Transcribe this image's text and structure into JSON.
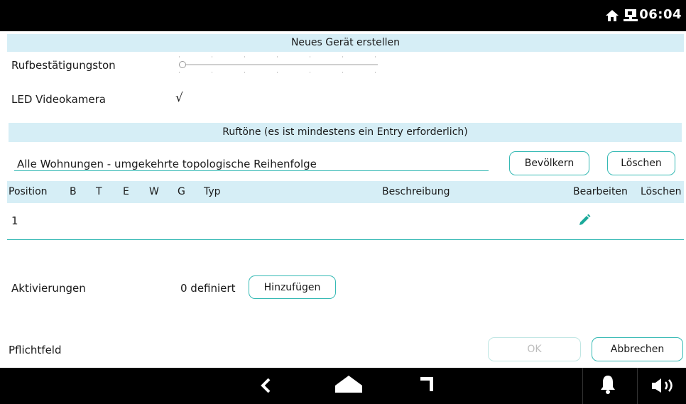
{
  "status": {
    "time": "06:04",
    "icons": [
      "home-icon",
      "network-icon"
    ]
  },
  "header": {
    "title": "Neues Gerät erstellen"
  },
  "form": {
    "ruf_label": "Rufbestätigungston",
    "ruf_slider_value": 0,
    "led_label": "LED Videokamera",
    "led_check": "√"
  },
  "ruftoene": {
    "title": "Ruftöne (es ist mindestens ein Entry erforderlich)",
    "selection": "Alle Wohnungen - umgekehrte topologische Reihenfolge",
    "populate": "Bevölkern",
    "delete": "Löschen"
  },
  "table": {
    "headers": {
      "position": "Position",
      "b": "B",
      "t": "T",
      "e": "E",
      "w": "W",
      "g": "G",
      "typ": "Typ",
      "beschreibung": "Beschreibung",
      "bearbeiten": "Bearbeiten",
      "loeschen": "Löschen"
    },
    "rows": [
      {
        "position": "1",
        "edit_icon": "pencil-icon"
      }
    ]
  },
  "aktivierungen": {
    "label": "Aktivierungen",
    "count": "0 definiert",
    "add": "Hinzufügen"
  },
  "footer": {
    "required": "Pflichtfeld",
    "ok": "OK",
    "cancel": "Abbrechen"
  },
  "nav": {
    "icons": [
      "back-icon",
      "home-icon",
      "recents-icon",
      "bell-icon",
      "volume-icon"
    ]
  },
  "colors": {
    "accent": "#35b9b4",
    "band": "#d6eef6",
    "edit": "#1aa99a"
  }
}
